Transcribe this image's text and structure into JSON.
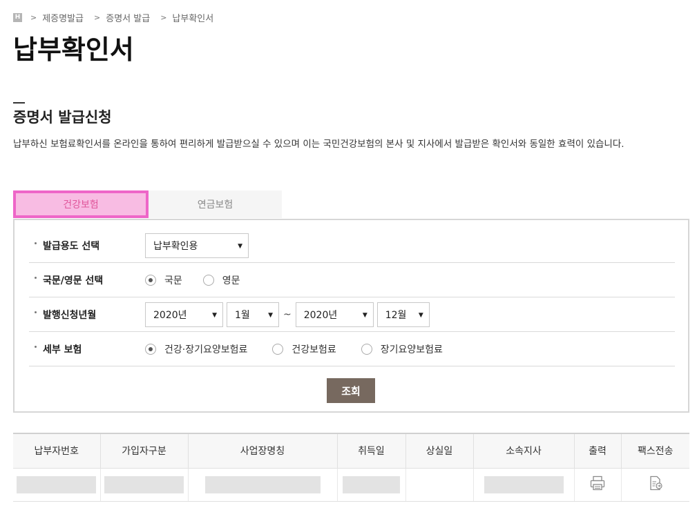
{
  "breadcrumb": {
    "home_icon": "H",
    "separator": ">",
    "items": [
      "제증명발급",
      "증명서 발급",
      "납부확인서"
    ]
  },
  "page_title": "납부확인서",
  "section": {
    "title": "증명서 발급신청",
    "description": "납부하신 보험료확인서를 온라인을 통하여 편리하게 발급받으실 수 있으며 이는 국민건강보험의 본사 및 지사에서 발급받은 확인서와 동일한 효력이 있습니다."
  },
  "tabs": [
    {
      "label": "건강보험",
      "active": true
    },
    {
      "label": "연금보험",
      "active": false
    }
  ],
  "form": {
    "purpose": {
      "label": "발급용도 선택",
      "selected": "납부확인용"
    },
    "language": {
      "label": "국문/영문 선택",
      "options": [
        "국문",
        "영문"
      ],
      "selected": "국문"
    },
    "period": {
      "label": "발행신청년월",
      "from_year": "2020년",
      "from_month": "1월",
      "separator": "~",
      "to_year": "2020년",
      "to_month": "12월"
    },
    "detail": {
      "label": "세부 보험",
      "options": [
        "건강·장기요양보험료",
        "건강보험료",
        "장기요양보험료"
      ],
      "selected": "건강·장기요양보험료"
    },
    "search_label": "조회"
  },
  "table": {
    "headers": [
      "납부자번호",
      "가입자구분",
      "사업장명칭",
      "취득일",
      "상실일",
      "소속지사",
      "출력",
      "팩스전송"
    ]
  },
  "icons": {
    "print": "printer-icon",
    "fax": "fax-document-icon"
  },
  "colors": {
    "active_tab_bg": "#f8bce3",
    "active_tab_border": "#ee66c8",
    "active_tab_text": "#e0559a",
    "search_button": "#77695f"
  }
}
